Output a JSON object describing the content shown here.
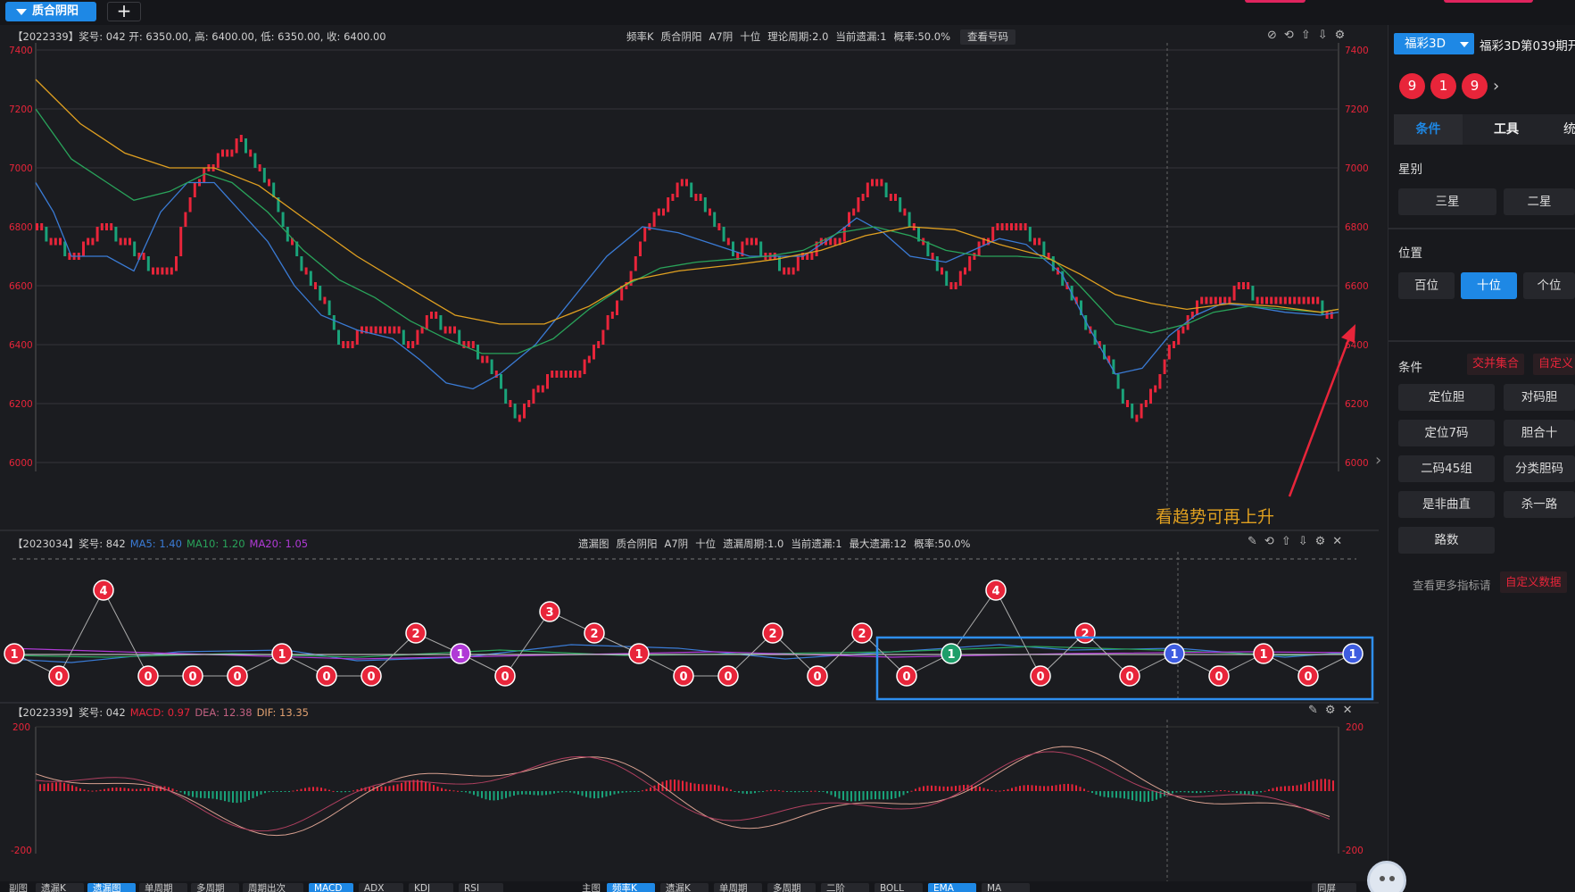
{
  "top": {
    "tab_label": "质合阴阳",
    "add_label": "+"
  },
  "kline": {
    "info": "【2022339】奖号: 042  开: 6350.00, 高: 6400.00, 低: 6350.00, 收: 6400.00",
    "center": [
      "频率K",
      "质合阴阳",
      "A7阴",
      "十位",
      "理论周期:2.0",
      "当前遗漏:1",
      "概率:50.0%"
    ],
    "check_button": "查看号码",
    "yticks": [
      "7400",
      "7200",
      "7000",
      "6800",
      "6600",
      "6400",
      "6200",
      "6000"
    ],
    "annotation": "看趋势可再上升"
  },
  "omit": {
    "info": "【2023034】奖号: 842",
    "ma5": "MA5: 1.40",
    "ma10": "MA10: 1.20",
    "ma20": "MA20: 1.05",
    "center": [
      "遗漏图",
      "质合阴阳",
      "A7阴",
      "十位",
      "遗漏周期:1.0",
      "当前遗漏:1",
      "最大遗漏:12",
      "概率:50.0%"
    ],
    "points": [
      1,
      0,
      4,
      0,
      0,
      0,
      1,
      0,
      0,
      2,
      1,
      0,
      3,
      2,
      1,
      0,
      0,
      2,
      0,
      2,
      0,
      1,
      4,
      0,
      2,
      0,
      1,
      0,
      1,
      0,
      1
    ],
    "special": {
      "10": "#b03ad6",
      "21": "#1e9e6a",
      "26": "#3e5ce0",
      "30": "#3e5ce0"
    }
  },
  "macd": {
    "info": "【2022339】奖号: 042",
    "macd": "MACD: 0.97",
    "dea": "DEA: 12.38",
    "dif": "DIF: 13.35",
    "yticks": [
      "200",
      "-200"
    ]
  },
  "right": {
    "lottery_select": "福彩3D",
    "period_title": "福彩3D第039期开",
    "balls": [
      "9",
      "1",
      "9"
    ],
    "tabs": [
      "条件",
      "工具",
      "统"
    ],
    "star_label": "星别",
    "star_buttons": [
      "三星",
      "二星"
    ],
    "pos_label": "位置",
    "pos_buttons": [
      "百位",
      "十位",
      "个位"
    ],
    "cond_label": "条件",
    "cond_tag1": "交并集合",
    "cond_tag2": "自定义",
    "cond_left": [
      "定位胆",
      "定位7码",
      "二码45组",
      "是非曲直",
      "路数"
    ],
    "cond_right": [
      "对码胆",
      "胆合十",
      "分类胆码",
      "杀一路"
    ],
    "more_text": "查看更多指标请",
    "custom_data": "自定义数据"
  },
  "bottom": {
    "sub_label": "副图",
    "sub_tabs": [
      "遗漏K",
      "遗漏图",
      "单周期",
      "多周期",
      "周期出次",
      "MACD",
      "ADX",
      "KDJ",
      "RSI"
    ],
    "main_label": "主图",
    "main_tabs": [
      "频率K",
      "遗漏K",
      "单周期",
      "多周期",
      "二阶",
      "BOLL",
      "EMA",
      "MA"
    ],
    "right_label": "同屏"
  },
  "colors": {
    "accent": "#1e88e5",
    "red": "#e8253a",
    "green": "#1aa37a",
    "ma5": "#3a7bd5",
    "ma10": "#29a35a",
    "ma20": "#e0a020",
    "magenta": "#b03ad6"
  }
}
